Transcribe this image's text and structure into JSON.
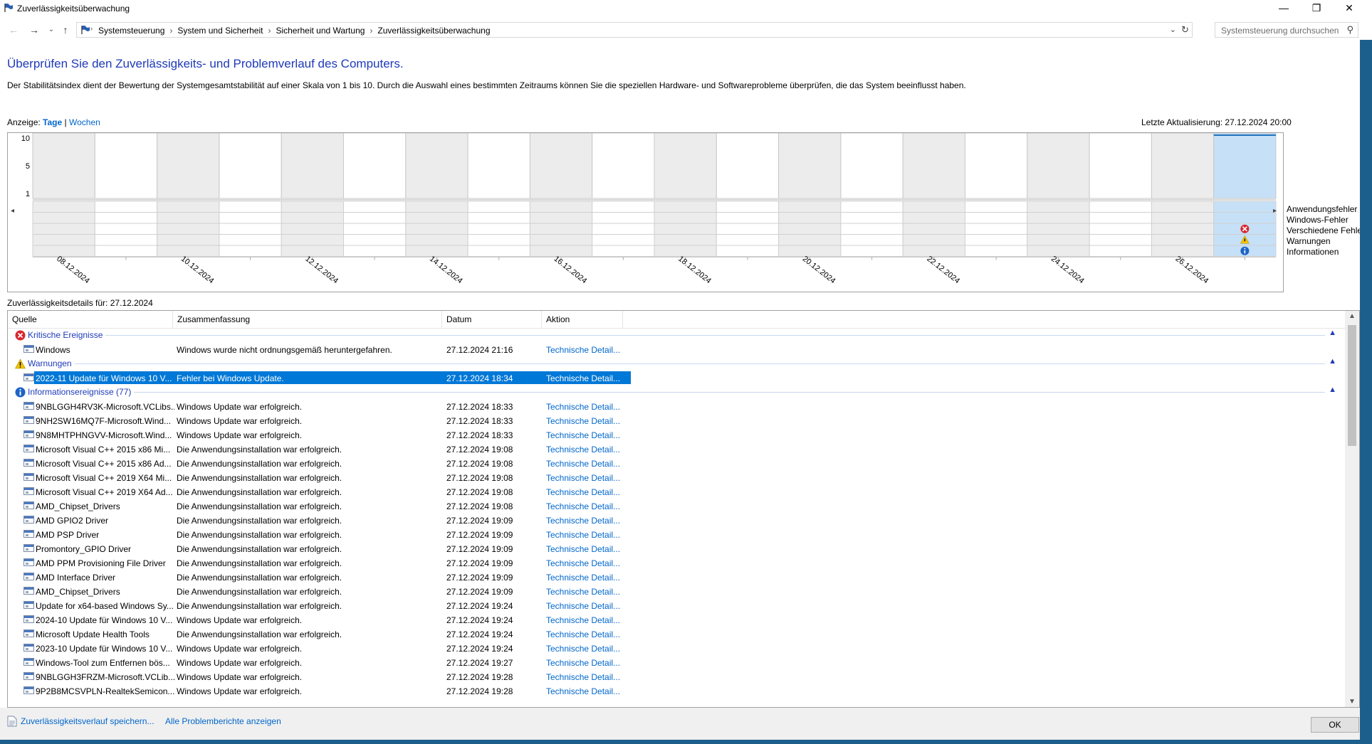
{
  "window": {
    "title": "Zuverlässigkeitsüberwachung",
    "controls": {
      "minimize": "—",
      "restore": "❐",
      "close": "✕"
    }
  },
  "nav": {
    "breadcrumbs": [
      "Systemsteuerung",
      "System und Sicherheit",
      "Sicherheit und Wartung",
      "Zuverlässigkeitsüberwachung"
    ],
    "search_placeholder": "Systemsteuerung durchsuchen"
  },
  "page": {
    "heading": "Überprüfen Sie den Zuverlässigkeits- und Problemverlauf des Computers.",
    "description": "Der Stabilitätsindex dient der Bewertung der Systemgesamtstabilität auf einer Skala von 1 bis 10. Durch die Auswahl eines bestimmten Zeitraums können Sie die speziellen Hardware- und Softwareprobleme überprüfen, die das System beeinflusst haben.",
    "view_label": "Anzeige:",
    "view_days": "Tage",
    "view_sep": "|",
    "view_weeks": "Wochen",
    "last_update": "Letzte Aktualisierung: 27.12.2024 20:00"
  },
  "chart_data": {
    "type": "timeline",
    "y_ticks": [
      "10",
      "5",
      "1"
    ],
    "date_labels": [
      "08.12.2024",
      "10.12.2024",
      "12.12.2024",
      "14.12.2024",
      "16.12.2024",
      "18.12.2024",
      "20.12.2024",
      "22.12.2024",
      "24.12.2024",
      "26.12.2024"
    ],
    "legend": [
      "Anwendungsfehler",
      "Windows-Fehler",
      "Verschiedene Fehler",
      "Warnungen",
      "Informationen"
    ],
    "columns": 20,
    "selected_column": 19,
    "events": [
      {
        "column": 19,
        "row": "Verschiedene Fehler",
        "icon": "error"
      },
      {
        "column": 19,
        "row": "Warnungen",
        "icon": "warning"
      },
      {
        "column": 19,
        "row": "Informationen",
        "icon": "info"
      }
    ],
    "colors": {
      "selected": "#c6e0f7",
      "alt_column": "#ececec",
      "stability_line": "#1e73be"
    }
  },
  "details": {
    "title": "Zuverlässigkeitsdetails für: 27.12.2024",
    "columns": [
      "Quelle",
      "Zusammenfassung",
      "Datum",
      "Aktion"
    ],
    "groups": [
      {
        "label": "Kritische Ereignisse",
        "icon": "error-icon",
        "rows": [
          {
            "source": "Windows",
            "summary": "Windows wurde nicht ordnungsgemäß heruntergefahren.",
            "date": "27.12.2024 21:16",
            "action": "Technische Detail..."
          }
        ]
      },
      {
        "label": "Warnungen",
        "icon": "warning-icon",
        "rows": [
          {
            "source": "2022-11 Update für Windows 10 V...",
            "summary": "Fehler bei Windows Update.",
            "date": "27.12.2024 18:34",
            "action": "Technische Detail...",
            "selected": true
          }
        ]
      },
      {
        "label": "Informationsereignisse (77)",
        "icon": "info-icon",
        "rows": [
          {
            "source": "9NBLGGH4RV3K-Microsoft.VCLibs...",
            "summary": "Windows Update war erfolgreich.",
            "date": "27.12.2024 18:33",
            "action": "Technische Detail..."
          },
          {
            "source": "9NH2SW16MQ7F-Microsoft.Wind...",
            "summary": "Windows Update war erfolgreich.",
            "date": "27.12.2024 18:33",
            "action": "Technische Detail..."
          },
          {
            "source": "9N8MHTPHNGVV-Microsoft.Wind...",
            "summary": "Windows Update war erfolgreich.",
            "date": "27.12.2024 18:33",
            "action": "Technische Detail..."
          },
          {
            "source": "Microsoft Visual C++ 2015 x86 Mi...",
            "summary": "Die Anwendungsinstallation war erfolgreich.",
            "date": "27.12.2024 19:08",
            "action": "Technische Detail..."
          },
          {
            "source": "Microsoft Visual C++ 2015 x86 Ad...",
            "summary": "Die Anwendungsinstallation war erfolgreich.",
            "date": "27.12.2024 19:08",
            "action": "Technische Detail..."
          },
          {
            "source": "Microsoft Visual C++ 2019 X64 Mi...",
            "summary": "Die Anwendungsinstallation war erfolgreich.",
            "date": "27.12.2024 19:08",
            "action": "Technische Detail..."
          },
          {
            "source": "Microsoft Visual C++ 2019 X64 Ad...",
            "summary": "Die Anwendungsinstallation war erfolgreich.",
            "date": "27.12.2024 19:08",
            "action": "Technische Detail..."
          },
          {
            "source": "AMD_Chipset_Drivers",
            "summary": "Die Anwendungsinstallation war erfolgreich.",
            "date": "27.12.2024 19:08",
            "action": "Technische Detail..."
          },
          {
            "source": "AMD GPIO2 Driver",
            "summary": "Die Anwendungsinstallation war erfolgreich.",
            "date": "27.12.2024 19:09",
            "action": "Technische Detail..."
          },
          {
            "source": "AMD PSP Driver",
            "summary": "Die Anwendungsinstallation war erfolgreich.",
            "date": "27.12.2024 19:09",
            "action": "Technische Detail..."
          },
          {
            "source": "Promontory_GPIO Driver",
            "summary": "Die Anwendungsinstallation war erfolgreich.",
            "date": "27.12.2024 19:09",
            "action": "Technische Detail..."
          },
          {
            "source": "AMD PPM Provisioning File Driver",
            "summary": "Die Anwendungsinstallation war erfolgreich.",
            "date": "27.12.2024 19:09",
            "action": "Technische Detail..."
          },
          {
            "source": "AMD Interface Driver",
            "summary": "Die Anwendungsinstallation war erfolgreich.",
            "date": "27.12.2024 19:09",
            "action": "Technische Detail..."
          },
          {
            "source": "AMD_Chipset_Drivers",
            "summary": "Die Anwendungsinstallation war erfolgreich.",
            "date": "27.12.2024 19:09",
            "action": "Technische Detail..."
          },
          {
            "source": "Update for x64-based Windows Sy...",
            "summary": "Die Anwendungsinstallation war erfolgreich.",
            "date": "27.12.2024 19:24",
            "action": "Technische Detail..."
          },
          {
            "source": "2024-10 Update für Windows 10 V...",
            "summary": "Windows Update war erfolgreich.",
            "date": "27.12.2024 19:24",
            "action": "Technische Detail..."
          },
          {
            "source": "Microsoft Update Health Tools",
            "summary": "Die Anwendungsinstallation war erfolgreich.",
            "date": "27.12.2024 19:24",
            "action": "Technische Detail..."
          },
          {
            "source": "2023-10 Update für Windows 10 V...",
            "summary": "Windows Update war erfolgreich.",
            "date": "27.12.2024 19:24",
            "action": "Technische Detail..."
          },
          {
            "source": "Windows-Tool zum Entfernen bös...",
            "summary": "Windows Update war erfolgreich.",
            "date": "27.12.2024 19:27",
            "action": "Technische Detail..."
          },
          {
            "source": "9NBLGGH3FRZM-Microsoft.VCLib...",
            "summary": "Windows Update war erfolgreich.",
            "date": "27.12.2024 19:28",
            "action": "Technische Detail..."
          },
          {
            "source": "9P2B8MCSVPLN-RealtekSemicon...",
            "summary": "Windows Update war erfolgreich.",
            "date": "27.12.2024 19:28",
            "action": "Technische Detail..."
          }
        ]
      }
    ]
  },
  "footer": {
    "save_link": "Zuverlässigkeitsverlauf speichern...",
    "reports_link": "Alle Problemberichte anzeigen",
    "ok_label": "OK"
  }
}
